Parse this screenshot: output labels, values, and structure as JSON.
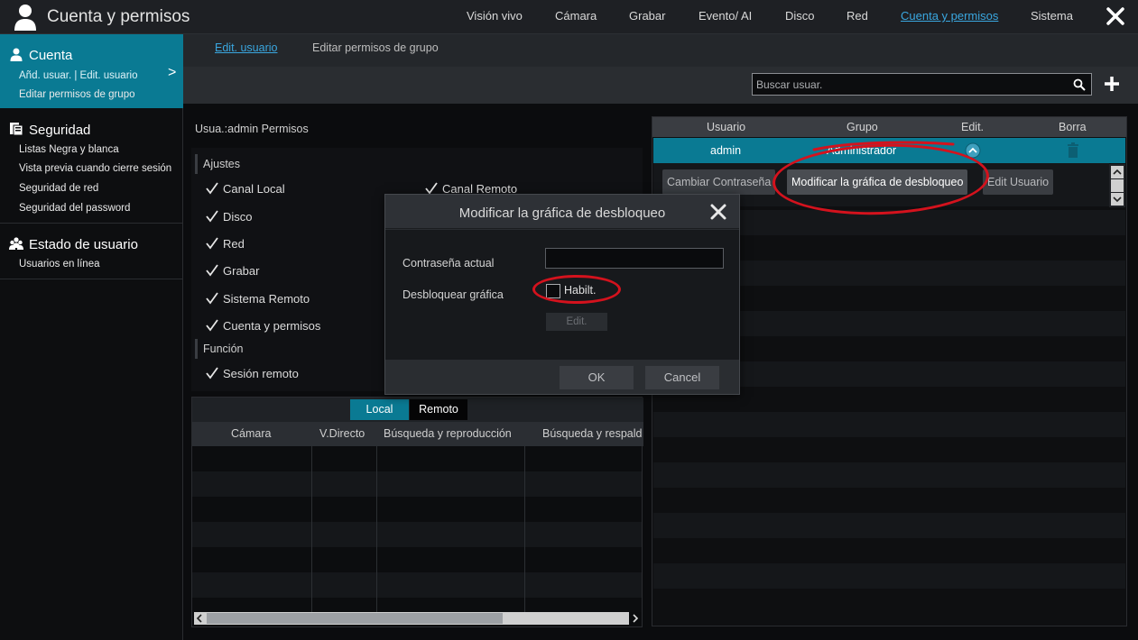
{
  "app": {
    "title": "Cuenta y permisos"
  },
  "topnav": [
    {
      "label": "Visión vivo",
      "active": false
    },
    {
      "label": "Cámara",
      "active": false
    },
    {
      "label": "Grabar",
      "active": false
    },
    {
      "label": "Evento/ AI",
      "active": false
    },
    {
      "label": "Disco",
      "active": false
    },
    {
      "label": "Red",
      "active": false
    },
    {
      "label": "Cuenta y permisos",
      "active": true
    },
    {
      "label": "Sistema",
      "active": false
    }
  ],
  "sidebar": {
    "cuenta": {
      "label": "Cuenta",
      "items": [
        "Añd. usuar. | Edit. usuario",
        "Editar permisos de grupo"
      ]
    },
    "seguridad": {
      "label": "Seguridad",
      "items": [
        "Listas Negra y blanca",
        "Vista previa cuando cierre sesión",
        "Seguridad de red",
        "Seguridad del password"
      ]
    },
    "estado": {
      "label": "Estado de usuario",
      "items": [
        "Usuarios en línea"
      ]
    }
  },
  "subtabs": {
    "edit_user": "Edit. usuario",
    "edit_group": "Editar permisos de grupo"
  },
  "search": {
    "placeholder": "Buscar usuar."
  },
  "permissions": {
    "title": "Usua.:admin Permisos",
    "section_ajustes": "Ajustes",
    "section_funcion": "Función",
    "items": [
      "Canal Local",
      "Disco",
      "Red",
      "Grabar",
      "Sistema Remoto",
      "Cuenta y permisos"
    ],
    "canal_remoto": "Canal Remoto",
    "funcion_items": [
      "Sesión remoto"
    ]
  },
  "lower_table": {
    "tabs": [
      "Local",
      "Remoto"
    ],
    "columns": [
      "Cámara",
      "V.Directo",
      "Búsqueda y reproducción",
      "Búsqueda y respaldo"
    ]
  },
  "users_table": {
    "columns": [
      "Usuario",
      "Grupo",
      "Edit.",
      "Borra"
    ],
    "rows": [
      {
        "usuario": "admin",
        "grupo": "Administrador"
      }
    ],
    "actions": [
      "Cambiar Contraseña",
      "Modificar la gráfica de desbloqueo",
      "Edit Usuario"
    ]
  },
  "modal": {
    "title": "Modificar la gráfica de desbloqueo",
    "current_password_label": "Contraseña actual",
    "current_password_value": "",
    "unlock_label": "Desbloquear gráfica",
    "enable_label": "Habilt.",
    "enable_checked": false,
    "edit_label": "Edit.",
    "ok_label": "OK",
    "cancel_label": "Cancel"
  },
  "colors": {
    "accent": "#0a7a93",
    "link": "#3aa7e0",
    "annotation": "#d4121d"
  }
}
